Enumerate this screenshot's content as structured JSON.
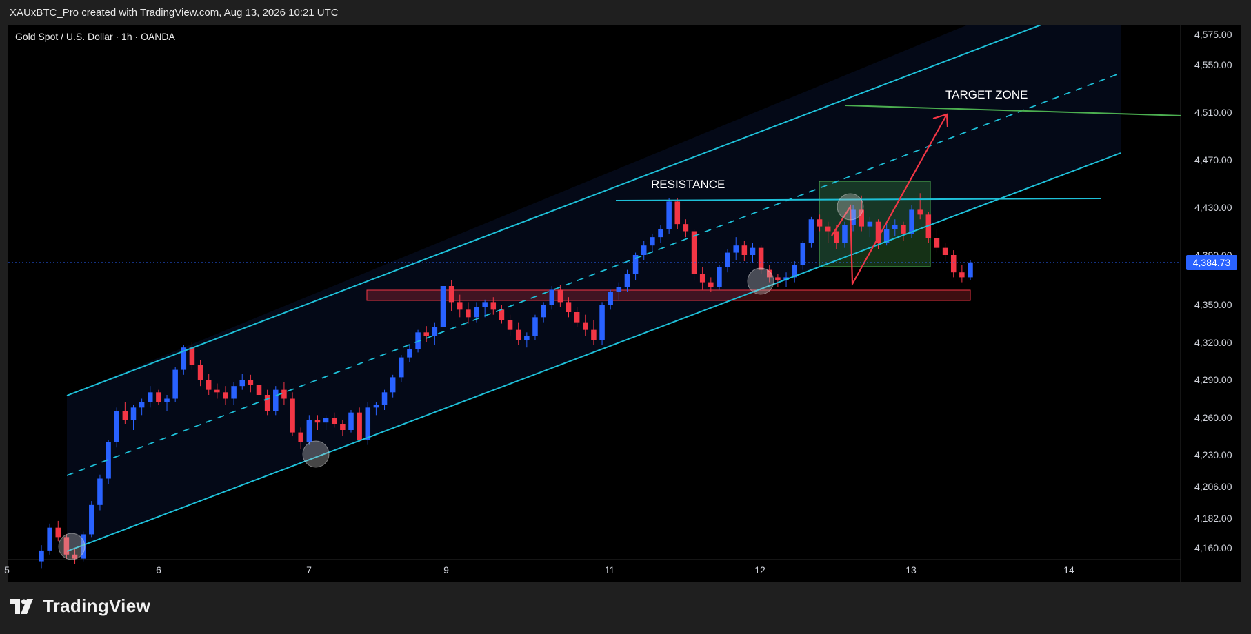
{
  "header": {
    "credit": "XAUxBTC_Pro created with TradingView.com, Aug 13, 2026 10:21 UTC"
  },
  "brand": {
    "name": "TradingView",
    "icon": "tradingview-logo-icon"
  },
  "colors": {
    "bull": "#2962ff",
    "bear": "#f23645",
    "channel": "#1ec0d8",
    "target": "#4caf50",
    "support_zone": "#f23645",
    "trade_box": "#4caf50",
    "arrow": "#f23645",
    "price_label_bg": "#2962ff"
  },
  "chart_data": {
    "type": "candlestick",
    "title": "Gold Spot / U.S. Dollar · 1h · OANDA",
    "x_ticks": [
      "5",
      "6",
      "7",
      "9",
      "11",
      "12",
      "13",
      "14"
    ],
    "y_ticks": [
      "4,575.00",
      "4,550.00",
      "4,510.00",
      "4,470.00",
      "4,430.00",
      "4,390.00",
      "4,350.00",
      "4,320.00",
      "4,290.00",
      "4,260.00",
      "4,230.00",
      "4,206.00",
      "4,182.00",
      "4,160.00"
    ],
    "last_price": "4,384.73",
    "annotations": {
      "resistance_label": "RESISTANCE",
      "resistance_level": 4432,
      "target_label": "TARGET ZONE",
      "target_level": 4512,
      "support_zone": [
        4362,
        4372
      ],
      "channel": "ascending parallel channel with dashed median line",
      "touch_markers": 4
    },
    "candles": [
      [
        4150,
        4162,
        4145,
        4158
      ],
      [
        4158,
        4178,
        4155,
        4175
      ],
      [
        4175,
        4180,
        4165,
        4168
      ],
      [
        4168,
        4170,
        4152,
        4155
      ],
      [
        4155,
        4160,
        4148,
        4152
      ],
      [
        4152,
        4172,
        4150,
        4170
      ],
      [
        4170,
        4195,
        4168,
        4192
      ],
      [
        4192,
        4215,
        4188,
        4212
      ],
      [
        4212,
        4242,
        4208,
        4240
      ],
      [
        4240,
        4268,
        4236,
        4265
      ],
      [
        4265,
        4272,
        4255,
        4258
      ],
      [
        4258,
        4270,
        4250,
        4268
      ],
      [
        4268,
        4275,
        4262,
        4272
      ],
      [
        4272,
        4285,
        4268,
        4280
      ],
      [
        4280,
        4282,
        4270,
        4272
      ],
      [
        4272,
        4278,
        4265,
        4275
      ],
      [
        4275,
        4300,
        4272,
        4298
      ],
      [
        4298,
        4318,
        4294,
        4316
      ],
      [
        4316,
        4320,
        4298,
        4302
      ],
      [
        4302,
        4306,
        4285,
        4290
      ],
      [
        4290,
        4295,
        4278,
        4282
      ],
      [
        4282,
        4287,
        4275,
        4280
      ],
      [
        4280,
        4285,
        4270,
        4275
      ],
      [
        4275,
        4288,
        4270,
        4285
      ],
      [
        4285,
        4295,
        4282,
        4290
      ],
      [
        4290,
        4294,
        4280,
        4286
      ],
      [
        4286,
        4290,
        4275,
        4278
      ],
      [
        4278,
        4282,
        4262,
        4265
      ],
      [
        4265,
        4285,
        4262,
        4282
      ],
      [
        4282,
        4288,
        4270,
        4275
      ],
      [
        4275,
        4280,
        4245,
        4248
      ],
      [
        4248,
        4252,
        4235,
        4240
      ],
      [
        4240,
        4262,
        4238,
        4258
      ],
      [
        4258,
        4262,
        4250,
        4256
      ],
      [
        4256,
        4262,
        4250,
        4260
      ],
      [
        4260,
        4264,
        4252,
        4255
      ],
      [
        4255,
        4258,
        4245,
        4250
      ],
      [
        4250,
        4266,
        4248,
        4264
      ],
      [
        4264,
        4268,
        4240,
        4242
      ],
      [
        4242,
        4272,
        4238,
        4268
      ],
      [
        4268,
        4272,
        4262,
        4270
      ],
      [
        4270,
        4282,
        4266,
        4280
      ],
      [
        4280,
        4294,
        4276,
        4292
      ],
      [
        4292,
        4310,
        4288,
        4308
      ],
      [
        4308,
        4318,
        4304,
        4315
      ],
      [
        4315,
        4330,
        4312,
        4328
      ],
      [
        4328,
        4333,
        4320,
        4325
      ],
      [
        4325,
        4336,
        4318,
        4332
      ],
      [
        4332,
        4370,
        4305,
        4365
      ],
      [
        4365,
        4370,
        4345,
        4352
      ],
      [
        4352,
        4358,
        4340,
        4346
      ],
      [
        4346,
        4352,
        4335,
        4340
      ],
      [
        4340,
        4352,
        4336,
        4348
      ],
      [
        4348,
        4354,
        4340,
        4352
      ],
      [
        4352,
        4356,
        4342,
        4346
      ],
      [
        4346,
        4350,
        4335,
        4338
      ],
      [
        4338,
        4342,
        4325,
        4330
      ],
      [
        4330,
        4336,
        4318,
        4322
      ],
      [
        4322,
        4328,
        4316,
        4325
      ],
      [
        4325,
        4342,
        4322,
        4340
      ],
      [
        4340,
        4352,
        4336,
        4350
      ],
      [
        4350,
        4365,
        4346,
        4362
      ],
      [
        4362,
        4366,
        4348,
        4352
      ],
      [
        4352,
        4356,
        4340,
        4344
      ],
      [
        4344,
        4348,
        4332,
        4336
      ],
      [
        4336,
        4342,
        4325,
        4330
      ],
      [
        4330,
        4338,
        4318,
        4322
      ],
      [
        4322,
        4352,
        4318,
        4350
      ],
      [
        4350,
        4362,
        4346,
        4360
      ],
      [
        4360,
        4368,
        4354,
        4364
      ],
      [
        4364,
        4378,
        4360,
        4375
      ],
      [
        4375,
        4392,
        4370,
        4390
      ],
      [
        4390,
        4402,
        4386,
        4398
      ],
      [
        4398,
        4408,
        4392,
        4405
      ],
      [
        4405,
        4415,
        4400,
        4412
      ],
      [
        4412,
        4438,
        4408,
        4435
      ],
      [
        4435,
        4438,
        4412,
        4416
      ],
      [
        4416,
        4420,
        4405,
        4410
      ],
      [
        4410,
        4412,
        4370,
        4375
      ],
      [
        4375,
        4380,
        4362,
        4368
      ],
      [
        4368,
        4372,
        4360,
        4364
      ],
      [
        4364,
        4382,
        4362,
        4380
      ],
      [
        4380,
        4395,
        4376,
        4392
      ],
      [
        4392,
        4405,
        4386,
        4398
      ],
      [
        4398,
        4402,
        4385,
        4390
      ],
      [
        4390,
        4400,
        4384,
        4396
      ],
      [
        4396,
        4398,
        4375,
        4378
      ],
      [
        4378,
        4382,
        4368,
        4372
      ],
      [
        4372,
        4375,
        4364,
        4370
      ],
      [
        4370,
        4376,
        4364,
        4372
      ],
      [
        4372,
        4385,
        4368,
        4382
      ],
      [
        4382,
        4402,
        4378,
        4400
      ],
      [
        4400,
        4422,
        4396,
        4420
      ],
      [
        4420,
        4424,
        4410,
        4414
      ],
      [
        4414,
        4418,
        4400,
        4410
      ],
      [
        4410,
        4415,
        4395,
        4400
      ],
      [
        4400,
        4418,
        4396,
        4415
      ],
      [
        4415,
        4432,
        4410,
        4428
      ],
      [
        4428,
        4440,
        4410,
        4414
      ],
      [
        4414,
        4422,
        4405,
        4418
      ],
      [
        4418,
        4420,
        4395,
        4400
      ],
      [
        4400,
        4418,
        4398,
        4412
      ],
      [
        4412,
        4420,
        4406,
        4415
      ],
      [
        4415,
        4418,
        4402,
        4408
      ],
      [
        4408,
        4432,
        4404,
        4428
      ],
      [
        4428,
        4442,
        4420,
        4424
      ],
      [
        4424,
        4426,
        4400,
        4404
      ],
      [
        4404,
        4412,
        4392,
        4396
      ],
      [
        4396,
        4400,
        4385,
        4390
      ],
      [
        4390,
        4394,
        4372,
        4376
      ],
      [
        4376,
        4382,
        4368,
        4372
      ],
      [
        4372,
        4386,
        4370,
        4384
      ]
    ]
  }
}
